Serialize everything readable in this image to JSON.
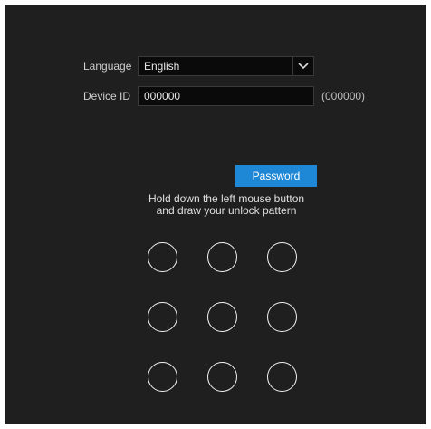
{
  "form": {
    "language_label": "Language",
    "language_value": "English",
    "device_id_label": "Device ID",
    "device_id_value": "000000",
    "device_id_hint": "(000000)"
  },
  "password_button_label": "Password",
  "instructions": {
    "line1": "Hold down the left mouse button",
    "line2": "and draw your unlock pattern"
  },
  "pattern_grid": {
    "rows": 3,
    "cols": 3
  },
  "colors": {
    "panel_bg": "#1f1f1f",
    "accent": "#1e88d6",
    "dot_stroke": "#f2f2f2"
  }
}
